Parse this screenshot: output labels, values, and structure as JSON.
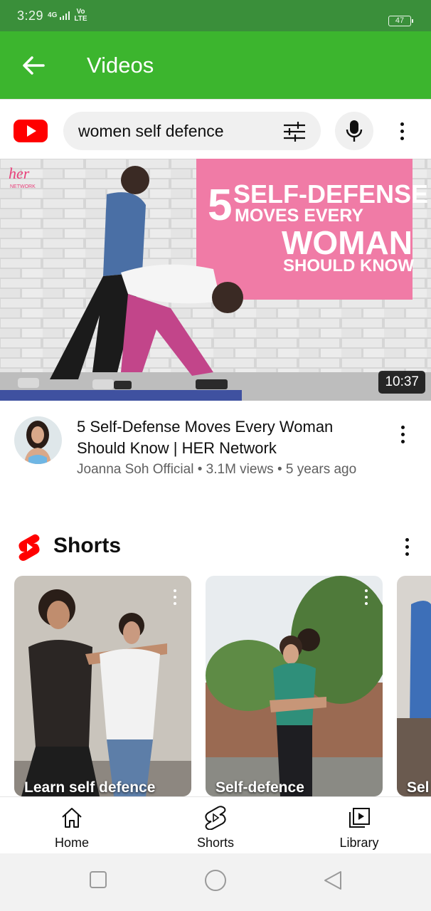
{
  "status_bar": {
    "time": "3:29",
    "network": "4G",
    "volte_top": "Vo",
    "volte_bottom": "LTE",
    "battery": "47"
  },
  "app_bar": {
    "title": "Videos",
    "back_icon": "arrow-left-icon",
    "background": "#3cb52e"
  },
  "yt_header": {
    "logo_icon": "youtube-logo-icon",
    "search_value": "women self defence",
    "filter_icon": "sliders-icon",
    "mic_icon": "mic-icon",
    "more_icon": "more-vertical-icon",
    "brand_red": "#ff0000"
  },
  "video": {
    "thumbnail_text": {
      "number": "5",
      "line1": "SELF-DEFENSE",
      "line2": "MOVES EVERY",
      "line3": "WOMAN",
      "line4": "SHOULD KNOW"
    },
    "brand_watermark": "her",
    "brand_watermark_sub": "NETWORK",
    "duration": "10:37",
    "title": "5 Self-Defense Moves Every Woman Should Know | HER Network",
    "channel": "Joanna Soh Official",
    "views": "3.1M views",
    "age": "5 years ago",
    "separator": "•"
  },
  "shorts": {
    "section_title": "Shorts",
    "logo_icon": "shorts-logo-icon",
    "items": [
      {
        "label": "Learn self defence"
      },
      {
        "label": "Self-defence"
      },
      {
        "label": "Sel"
      }
    ]
  },
  "bottom_nav": {
    "items": [
      {
        "label": "Home",
        "icon": "home-icon"
      },
      {
        "label": "Shorts",
        "icon": "shorts-icon"
      },
      {
        "label": "Library",
        "icon": "library-icon"
      }
    ]
  },
  "system_nav": {
    "recents_icon": "square-icon",
    "home_icon": "circle-icon",
    "back_icon": "triangle-back-icon"
  }
}
